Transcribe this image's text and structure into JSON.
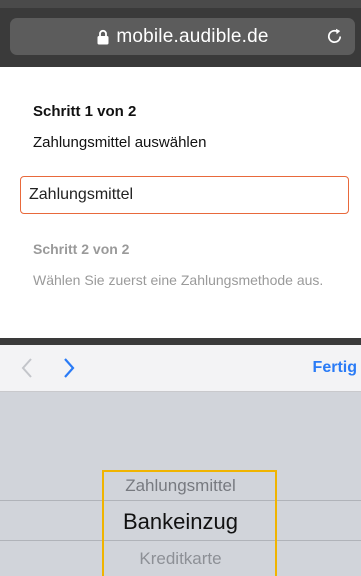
{
  "browser": {
    "url": "mobile.audible.de"
  },
  "step1": {
    "title": "Schritt 1 von 2",
    "description": "Zahlungsmittel auswählen",
    "select_value": "Zahlungsmittel"
  },
  "step2": {
    "title": "Schritt 2 von 2",
    "description": "Wählen Sie zuerst eine Zahlungsmethode aus."
  },
  "toolbar": {
    "done_label": "Fertig"
  },
  "picker": {
    "options": [
      "Zahlungsmittel",
      "Bankeinzug",
      "Kreditkarte"
    ],
    "selected": "Bankeinzug"
  },
  "colors": {
    "accent": "#2a7bf6",
    "field_border": "#e8693b",
    "highlight": "#f0b400"
  }
}
